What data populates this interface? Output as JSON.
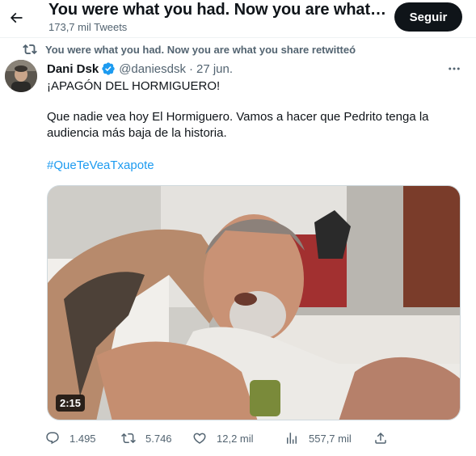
{
  "header": {
    "back_icon": "arrow-left-icon",
    "title": "You were what you had. Now you are what you share",
    "tweet_count": "173,7 mil Tweets",
    "follow_label": "Seguir"
  },
  "retweet_banner": {
    "icon": "retweet-icon",
    "text": "You were what you had. Now you are what you share retwitteó"
  },
  "tweet": {
    "author_name": "Dani Dsk",
    "verified_icon": "verified-badge-icon",
    "verified_color": "#1d9bf0",
    "handle": "@daniesdsk",
    "separator": "·",
    "date": "27 jun.",
    "more_icon": "more-horizontal-icon",
    "text_line_1": "¡APAGÓN DEL HORMIGUERO!",
    "text_line_2": "Que nadie vea hoy El Hormiguero. Vamos a hacer que Pedrito tenga la",
    "text_line_3": "audiencia más baja de la historia.",
    "hashtag": "#QueTeVeaTxapote",
    "hashtag_color": "#1d9bf0",
    "video_duration": "2:15"
  },
  "actions": {
    "reply": {
      "icon": "reply-icon",
      "count": "1.495"
    },
    "retweet": {
      "icon": "retweet-icon",
      "count": "5.746"
    },
    "like": {
      "icon": "heart-icon",
      "count": "12,2 mil"
    },
    "views": {
      "icon": "views-chart-icon",
      "count": "557,7 mil"
    },
    "share": {
      "icon": "share-icon"
    }
  }
}
